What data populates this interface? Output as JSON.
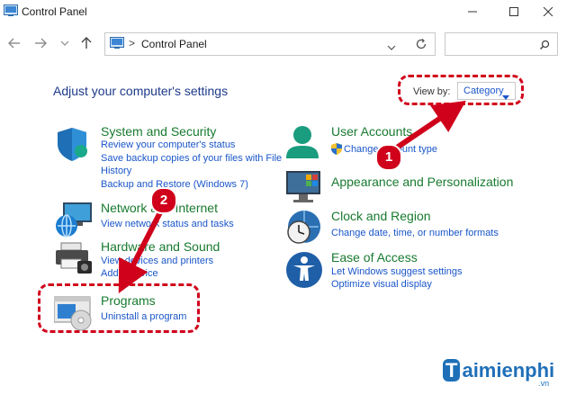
{
  "window": {
    "title": "Control Panel",
    "controls": {
      "minimize": "—",
      "maximize": "☐",
      "close": "✕"
    }
  },
  "address": {
    "breadcrumb": "Control Panel",
    "separator": ">",
    "search_placeholder": ""
  },
  "main": {
    "heading": "Adjust your computer's settings",
    "view_by_label": "View by:",
    "view_by_value": "Category"
  },
  "categories": [
    {
      "title": "System and Security",
      "links": [
        "Review your computer's status",
        "Save backup copies of your files with File",
        "History",
        "Backup and Restore (Windows 7)"
      ]
    },
    {
      "title": "Network and Internet",
      "links": [
        "View network status and tasks"
      ]
    },
    {
      "title": "Hardware and Sound",
      "links": [
        "View devices and printers",
        "Add a device"
      ]
    },
    {
      "title": "Programs",
      "links": [
        "Uninstall a program"
      ]
    },
    {
      "title": "User Accounts",
      "links": [
        "Change account type"
      ]
    },
    {
      "title": "Appearance and Personalization",
      "links": []
    },
    {
      "title": "Clock and Region",
      "links": [
        "Change date, time, or number formats"
      ]
    },
    {
      "title": "Ease of Access",
      "links": [
        "Let Windows suggest settings",
        "Optimize visual display"
      ]
    }
  ],
  "annotations": {
    "step1": "1",
    "step2": "2",
    "color": "#d0021b"
  },
  "watermark": {
    "brand_initial": "T",
    "brand_rest": "aimienphi",
    "suffix": ".vn"
  }
}
